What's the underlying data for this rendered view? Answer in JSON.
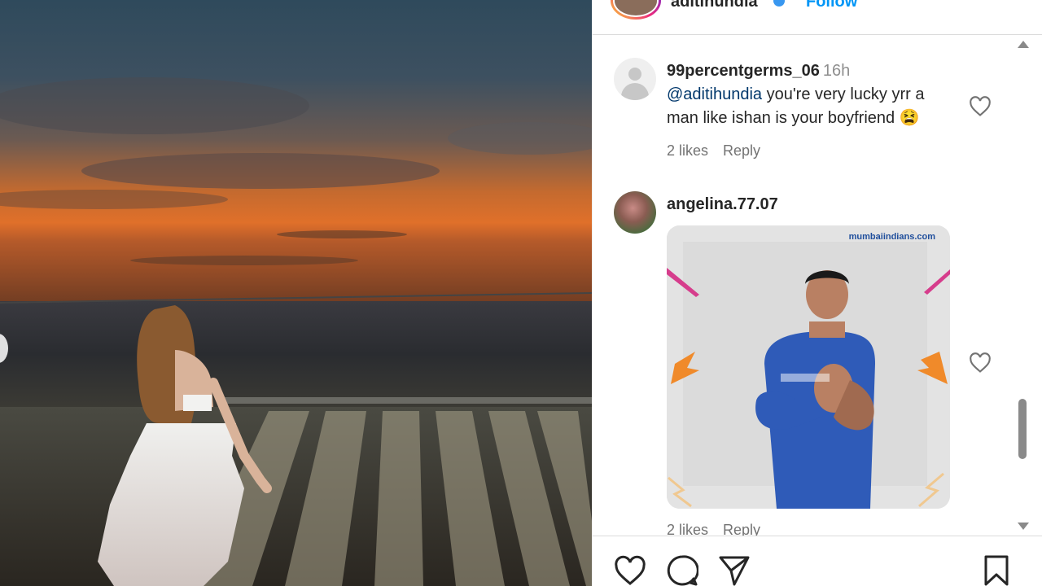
{
  "header": {
    "username": "aditihundia",
    "follow_label": "Follow"
  },
  "comments": [
    {
      "username": "99percentgerms_06",
      "time": "16h",
      "mention": "@aditihundia",
      "text_line1": " you're very lucky yrr a",
      "text_line2": "man like ishan is your boyfriend 😫",
      "likes": "2 likes",
      "reply_label": "Reply"
    },
    {
      "username": "angelina.77.07",
      "gif_watermark": "mumbaiindians.com",
      "likes": "2 likes",
      "reply_label": "Reply"
    }
  ],
  "colors": {
    "link": "#00376b",
    "follow": "#0095f6",
    "muted": "#737373"
  },
  "icons": [
    "like-icon",
    "comment-icon",
    "share-icon",
    "save-icon",
    "heart-icon",
    "verified-icon"
  ]
}
